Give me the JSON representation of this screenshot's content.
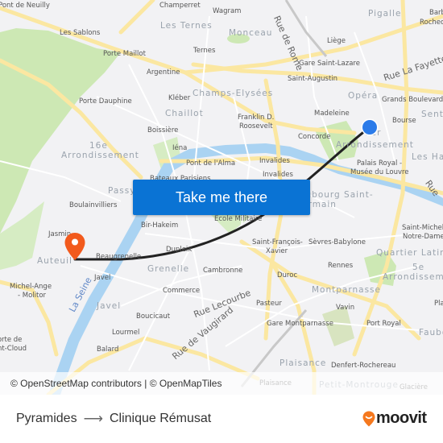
{
  "map": {
    "labels": {
      "pont_de_neuilly": "Pont de Neuilly",
      "champerret": "Champerret",
      "wagram": "Wagram",
      "pigalle": "Pigalle",
      "barbes": "Barbès-",
      "rochech": "Rochech",
      "les_sablons": "Les Sablons",
      "les_ternes": "Les Ternes",
      "monceau": "Monceau",
      "rue_de_rome": "Rue de Rome",
      "liege": "Liège",
      "porte_maillot": "Porte Maillot",
      "ternes": "Ternes",
      "gare_saint_lazare": "Gare Saint-Lazare",
      "rue_la_fayette": "Rue La Fayette",
      "argentine": "Argentine",
      "saint_augustin": "Saint-Augustin",
      "champs_elysees": "Champs-Elysées",
      "opera": "Opéra",
      "grands_boulevards": "Grands Boulevards",
      "porte_dauphine": "Porte Dauphine",
      "kleber": "Kléber",
      "chaillot": "Chaillot",
      "franklin_1": "Franklin D.",
      "franklin_2": "Roosevelt",
      "madeleine": "Madeleine",
      "bourse": "Bourse",
      "sentier": "Sentier",
      "boissiere": "Boissière",
      "concorde": "Concorde",
      "arr1_a": "1er",
      "arr1_b": "Arrondissement",
      "arr16_a": "16e",
      "arr16_b": "Arrondissement",
      "iena": "Iéna",
      "pont_alma": "Pont de l'Alma",
      "les_halles": "Les Halles",
      "invalides1": "Invalides",
      "invalides2": "Invalides",
      "palais_royal_1": "Palais Royal -",
      "palais_royal_2": "Musée du Louvre",
      "bateaux": "Bateaux Parisiens",
      "passy": "Passy",
      "faubourg_1": "Faubourg Saint-",
      "faubourg_2": "Germain",
      "rue_r": "Rue",
      "boulainvilliers": "Boulainvilliers",
      "ecole_militaire": "École Militaire",
      "bir_hakeim": "Bir-Hakeim",
      "jasmin": "Jasmin",
      "saint_michel_1": "Saint-Michel -",
      "saint_michel_2": "Notre-Dame",
      "dupleix": "Dupleix",
      "saint_francois_1": "Saint-François-",
      "saint_francois_2": "Xavier",
      "sevres_babylone": "Sèvres-Babylone",
      "auteuil": "Auteuil",
      "beaugrenelle": "Beaugrenelle",
      "quartier_latin": "Quartier Latin",
      "grenelle": "Grenelle",
      "cambronne": "Cambronne",
      "rennes": "Rennes",
      "arr5_a": "5e",
      "arr5_b": "Arrondissement",
      "michel_ange_1": "Michel-Ange",
      "michel_ange_2": "- Molitor",
      "javel_station": "Javel",
      "duroc": "Duroc",
      "la_seine": "La Seine",
      "commerce": "Commerce",
      "montparnasse": "Montparnasse",
      "javel_dist": "Javel",
      "rue_lecourbe": "Rue Lecourbe",
      "pasteur": "Pasteur",
      "vavin": "Vavin",
      "place": "Pla",
      "boucicaut": "Boucicaut",
      "gare_montparnasse": "Gare Montparnasse",
      "lourmel": "Lourmel",
      "port_royal": "Port Royal",
      "faubourg_r": "Faubo",
      "rue_vaugirard": "Rue de Vaugirard",
      "porte_st_cloud_1": "Porte de",
      "porte_st_cloud_2": "Saint-Cloud",
      "balard": "Balard",
      "plaisance_dist": "Plaisance",
      "denfert": "Denfert-Rochereau",
      "plaisance": "Plaisance",
      "petit_montrouge": "Petit-Montrouge",
      "glaciere": "Glacière"
    },
    "origin_marker": {
      "name": "Pyramides",
      "color": "#2b7be9"
    },
    "destination_marker": {
      "name": "Clinique Rémusat",
      "color": "#f25a1c"
    },
    "route_color": "#222222"
  },
  "cta": {
    "label": "Take me there",
    "color": "#0a73d4"
  },
  "attribution": "© OpenStreetMap contributors | © OpenMapTiles",
  "footer": {
    "origin": "Pyramides",
    "arrow": "⟶",
    "destination": "Clinique Rémusat",
    "logo_text": "moovit",
    "logo_color": "#f5781e"
  }
}
